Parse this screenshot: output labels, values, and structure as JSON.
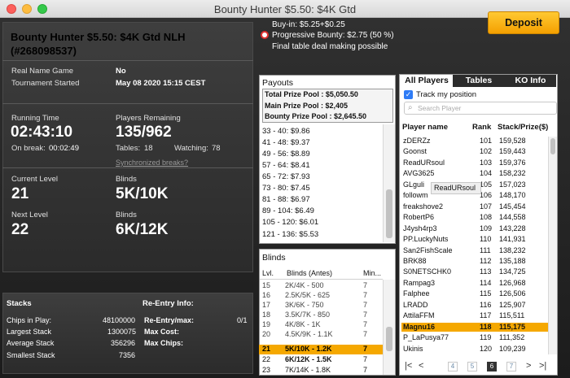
{
  "window": {
    "title": "Bounty Hunter $5.50: $4K Gtd"
  },
  "header": {
    "buyin": "Buy-in: $5.25+$0.25",
    "progressive": "Progressive Bounty: $2.75 (50 %)",
    "final_table": "Final table deal making possible",
    "deposit_label": "Deposit"
  },
  "info": {
    "title_line1": "Bounty Hunter $5.50: $4K Gtd NLH",
    "title_line2": "(#268098537)",
    "real_name_label": "Real Name Game",
    "real_name_value": "No",
    "started_label": "Tournament Started",
    "started_value": "May 08 2020 15:15 CEST",
    "running_label": "Running Time",
    "running_value": "02:43:10",
    "break_label": "On break:",
    "break_value": "00:02:49",
    "remaining_label": "Players Remaining",
    "remaining_value": "135/962",
    "tables_label": "Tables:",
    "tables_value": "18",
    "watching_label": "Watching:",
    "watching_value": "78",
    "sync_link": "Synchronized breaks?",
    "current_level_label": "Current Level",
    "current_level_value": "21",
    "blinds_label": "Blinds",
    "current_blinds": "5K/10K",
    "next_level_label": "Next Level",
    "next_level_value": "22",
    "next_blinds_label": "Blinds",
    "next_blinds": "6K/12K"
  },
  "stacks": {
    "title": "Stacks",
    "rows": [
      {
        "label": "Chips in Play:",
        "value": "48100000"
      },
      {
        "label": "Largest Stack",
        "value": "1300075"
      },
      {
        "label": "Average Stack",
        "value": "356296"
      },
      {
        "label": "Smallest Stack",
        "value": "7356"
      }
    ]
  },
  "reentry": {
    "title": "Re-Entry Info:",
    "rows": [
      {
        "label": "Re-Entry/max:",
        "value": "0/1"
      },
      {
        "label": "Max Cost:",
        "value": ""
      },
      {
        "label": "Max Chips:",
        "value": ""
      }
    ]
  },
  "payouts": {
    "title": "Payouts",
    "total": "Total Prize Pool : $5,050.50",
    "main": "Main Prize Pool : $2,405",
    "bounty": "Bounty Prize Pool : $2,645.50",
    "rows": [
      "33 - 40: $9.86",
      "41 - 48: $9.37",
      "49 - 56: $8.89",
      "57 - 64: $8.41",
      "65 - 72: $7.93",
      "73 - 80: $7.45",
      "81 - 88: $6.97",
      "89 - 104: $6.49",
      "105 - 120: $6.01",
      "121 - 136: $5.53"
    ]
  },
  "blinds": {
    "title": "Blinds",
    "col_level": "Lvl.",
    "col_blinds": "Blinds (Antes)",
    "col_min": "Min...",
    "rows": [
      {
        "lvl": "15",
        "blinds": "2K/4K - 500",
        "min": "7"
      },
      {
        "lvl": "16",
        "blinds": "2.5K/5K - 625",
        "min": "7"
      },
      {
        "lvl": "17",
        "blinds": "3K/6K - 750",
        "min": "7"
      },
      {
        "lvl": "18",
        "blinds": "3.5K/7K - 850",
        "min": "7"
      },
      {
        "lvl": "19",
        "blinds": "4K/8K - 1K",
        "min": "7"
      },
      {
        "lvl": "20",
        "blinds": "4.5K/9K - 1.1K",
        "min": "7"
      },
      {
        "lvl": "21",
        "blinds": "5K/10K - 1.2K",
        "min": "7"
      },
      {
        "lvl": "22",
        "blinds": "6K/12K - 1.5K",
        "min": "7"
      },
      {
        "lvl": "23",
        "blinds": "7K/14K - 1.8K",
        "min": "7"
      }
    ]
  },
  "players": {
    "tabs": [
      "All Players",
      "Tables",
      "KO Info"
    ],
    "track_label": "Track my position",
    "search_placeholder": "Search Player",
    "col_name": "Player name",
    "col_rank": "Rank",
    "col_stack": "Stack/Prize($)",
    "tooltip": "ReadURsoul",
    "rows": [
      {
        "name": "zDERZz",
        "rank": "101",
        "stack": "159,528"
      },
      {
        "name": "Goonst",
        "rank": "102",
        "stack": "159,443"
      },
      {
        "name": "ReadURsoul",
        "rank": "103",
        "stack": "159,376"
      },
      {
        "name": "AVG3625",
        "rank": "104",
        "stack": "158,232"
      },
      {
        "name": "GLguli",
        "rank": "105",
        "stack": "157,023"
      },
      {
        "name": "followm",
        "rank": "106",
        "stack": "148,170"
      },
      {
        "name": "freakshove2",
        "rank": "107",
        "stack": "145,454"
      },
      {
        "name": "RobertP6",
        "rank": "108",
        "stack": "144,558"
      },
      {
        "name": "J4ysh4rp3",
        "rank": "109",
        "stack": "143,228"
      },
      {
        "name": "PP.LuckyNuts",
        "rank": "110",
        "stack": "141,931"
      },
      {
        "name": "San2FishScale",
        "rank": "111",
        "stack": "138,232"
      },
      {
        "name": "BRK88",
        "rank": "112",
        "stack": "135,188"
      },
      {
        "name": "S0NETSCHK0",
        "rank": "113",
        "stack": "134,725"
      },
      {
        "name": "Rampag3",
        "rank": "114",
        "stack": "126,968"
      },
      {
        "name": "Falphee",
        "rank": "115",
        "stack": "126,506"
      },
      {
        "name": "LRADD",
        "rank": "116",
        "stack": "125,907"
      },
      {
        "name": "AttilaFFM",
        "rank": "117",
        "stack": "115,511"
      },
      {
        "name": "Magnu16",
        "rank": "118",
        "stack": "115,175"
      },
      {
        "name": "P_LaPusya77",
        "rank": "119",
        "stack": "111,352"
      },
      {
        "name": "Ukinis",
        "rank": "120",
        "stack": "109,239"
      }
    ],
    "highlight_index": 17,
    "pages": [
      "4",
      "5",
      "6",
      "7"
    ],
    "current_page": "6"
  }
}
